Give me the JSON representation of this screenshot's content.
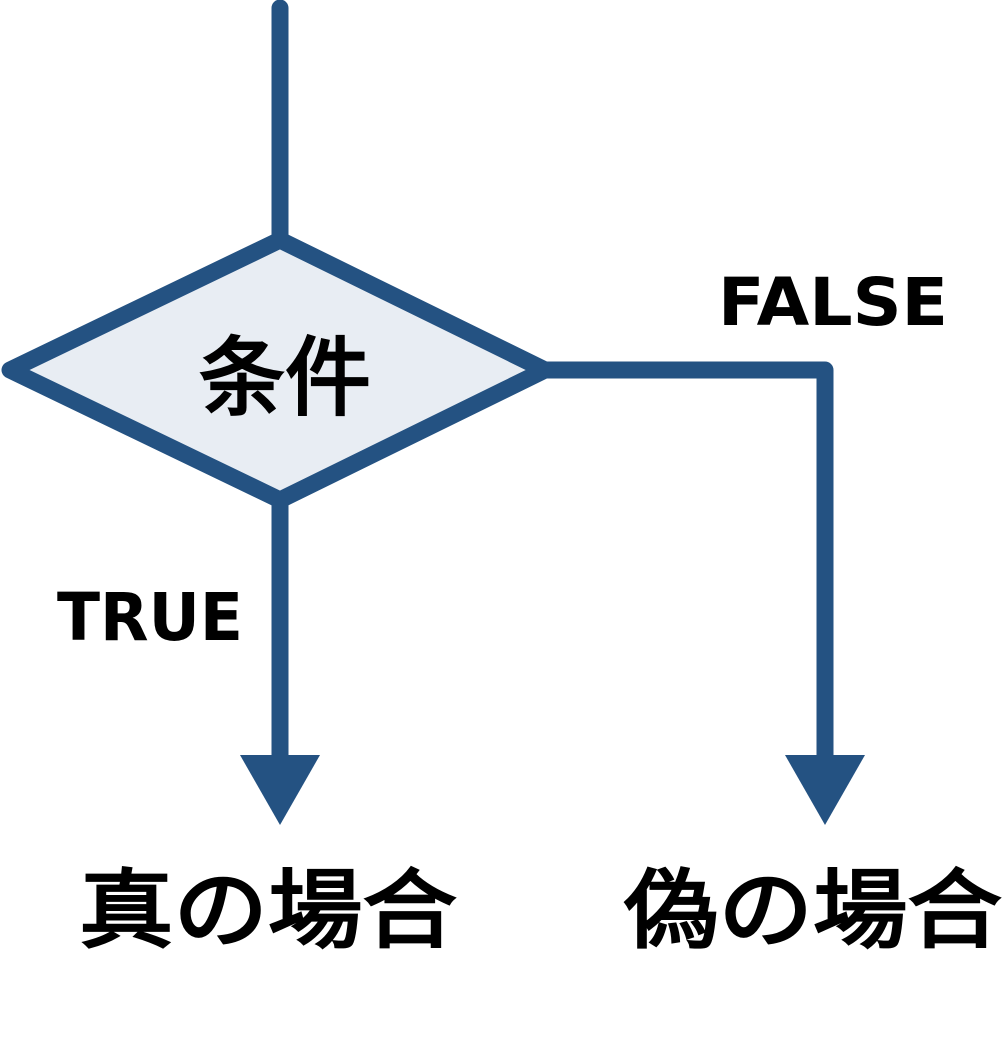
{
  "decision": {
    "label": "条件"
  },
  "branches": {
    "true_label": "TRUE",
    "false_label": "FALSE"
  },
  "outcomes": {
    "true_result": "真の場合",
    "false_result": "偽の場合"
  },
  "colors": {
    "line": "#245282",
    "decision_fill": "#e8edf3",
    "text": "#000000"
  }
}
